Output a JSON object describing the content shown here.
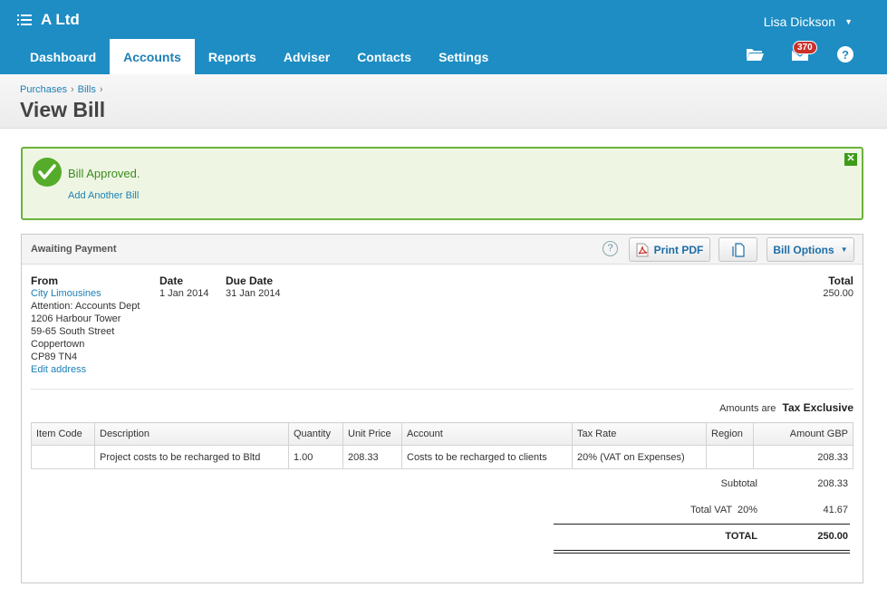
{
  "header": {
    "org_name": "A Ltd",
    "user_name": "Lisa Dickson",
    "nav": [
      "Dashboard",
      "Accounts",
      "Reports",
      "Adviser",
      "Contacts",
      "Settings"
    ],
    "active_tab": "Accounts",
    "inbox_count": "370"
  },
  "breadcrumb": [
    "Purchases",
    "Bills"
  ],
  "page_title": "View Bill",
  "notice": {
    "message": "Bill Approved.",
    "link": "Add Another Bill",
    "close": "✕"
  },
  "bill": {
    "status": "Awaiting Payment",
    "help": "?",
    "print_pdf": "Print PDF",
    "bill_options": "Bill Options",
    "from_label": "From",
    "from_name": "City Limousines",
    "address": [
      "Attention: Accounts Dept",
      "1206 Harbour Tower",
      "59-65 South Street",
      "Coppertown",
      "CP89 TN4"
    ],
    "edit_address": "Edit address",
    "date_label": "Date",
    "date": "1 Jan 2014",
    "due_date_label": "Due Date",
    "due_date": "31 Jan 2014",
    "total_label": "Total",
    "total": "250.00",
    "amounts_are_label": "Amounts are",
    "amounts_are": "Tax Exclusive",
    "columns": [
      "Item Code",
      "Description",
      "Quantity",
      "Unit Price",
      "Account",
      "Tax Rate",
      "Region",
      "Amount GBP"
    ],
    "line_items": [
      {
        "item_code": "",
        "description": "Project costs to be recharged to Bltd",
        "quantity": "1.00",
        "unit_price": "208.33",
        "account": "Costs to be recharged to clients",
        "tax_rate": "20% (VAT on Expenses)",
        "region": "",
        "amount": "208.33"
      }
    ],
    "subtotal_label": "Subtotal",
    "subtotal": "208.33",
    "vat_label": "Total VAT  20%",
    "vat": "41.67",
    "grand_total_label": "TOTAL",
    "grand_total": "250.00"
  },
  "colors": {
    "brand_blue": "#1d8dc4",
    "success_green": "#55ac2a",
    "badge_red": "#c9312a",
    "link_blue": "#1d7fb5"
  }
}
